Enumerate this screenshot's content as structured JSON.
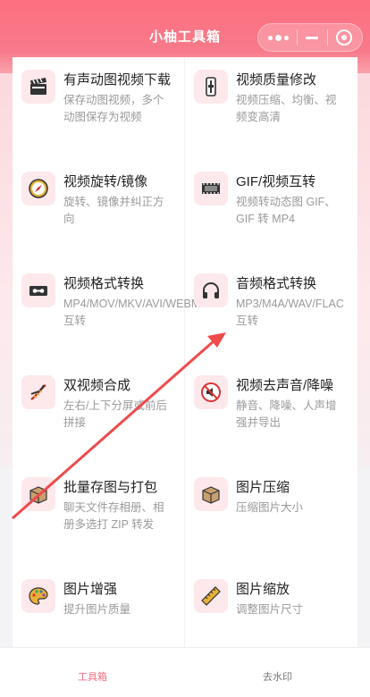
{
  "header": {
    "title": "小柚工具箱"
  },
  "capsule": {
    "more_icon": "more-dots-icon",
    "minimize_icon": "minimize-icon",
    "close_icon": "target-close-icon"
  },
  "tools": [
    {
      "title": "有声动图视频下载",
      "desc": "保存动图视频，多个动图保存为视频",
      "icon": "clapperboard-icon"
    },
    {
      "title": "视频质量修改",
      "desc": "视频压缩、均衡、视频变高清",
      "icon": "slider-icon"
    },
    {
      "title": "视频旋转/镜像",
      "desc": "旋转、镜像并纠正方向",
      "icon": "compass-icon"
    },
    {
      "title": "GIF/视频互转",
      "desc": "视频转动态图 GIF、GIF 转 MP4",
      "icon": "film-strip-icon"
    },
    {
      "title": "视频格式转换",
      "desc": "MP4/MOV/MKV/AVI/WEBM 互转",
      "icon": "videotape-icon"
    },
    {
      "title": "音频格式转换",
      "desc": "MP3/M4A/WAV/FLAC 互转",
      "icon": "headphones-icon"
    },
    {
      "title": "双视频合成",
      "desc": "左右/上下分屏或前后拼接",
      "icon": "dna-icon"
    },
    {
      "title": "视频去声音/降噪",
      "desc": "静音、降噪、人声增强并导出",
      "icon": "mute-icon"
    },
    {
      "title": "批量存图与打包",
      "desc": "聊天文件存相册、相册多选打 ZIP 转发",
      "icon": "package-icon"
    },
    {
      "title": "图片压缩",
      "desc": "压缩图片大小",
      "icon": "box-icon"
    },
    {
      "title": "图片增强",
      "desc": "提升图片质量",
      "icon": "palette-icon"
    },
    {
      "title": "图片缩放",
      "desc": "调整图片尺寸",
      "icon": "ruler-icon"
    }
  ],
  "tabbar": {
    "tab1": "工具箱",
    "tab2": "去水印"
  },
  "colors": {
    "accent": "#fc6f80",
    "active_tab": "#f06f84",
    "arrow": "#ee4b4b"
  }
}
